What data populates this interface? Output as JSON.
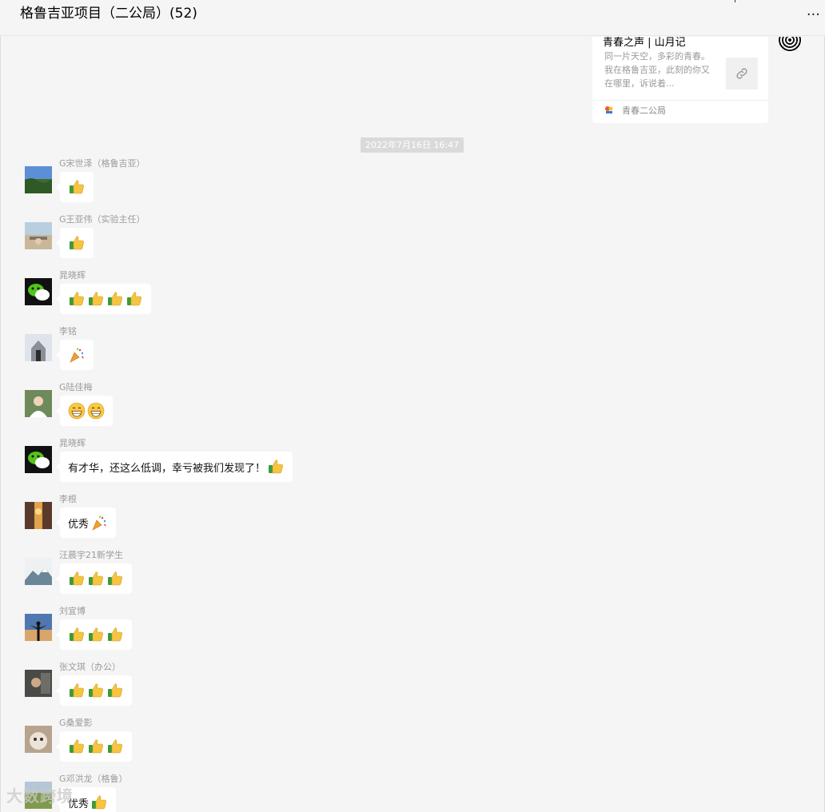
{
  "header": {
    "title": "格鲁吉亚项目（二公局）(52)",
    "more_icon": "more-horizontal-icon"
  },
  "link_card": {
    "title": "青春之声 | 山月记",
    "description": "同一片天空，多彩的青春。我在格鲁吉亚，此刻的你又在哪里，诉说着...",
    "thumb_icon": "link-icon",
    "source": "青春二公局"
  },
  "timestamp": "2022年7月16日 16:47",
  "messages": [
    {
      "sender": "G宋世泽（格鲁吉亚）",
      "avatar": "landscape-avatar",
      "text": "",
      "emojis": [
        "thumbs-up"
      ]
    },
    {
      "sender": "G王亚伟（实验主任）",
      "avatar": "road-avatar",
      "text": "",
      "emojis": [
        "thumbs-up"
      ]
    },
    {
      "sender": "晁晓辉",
      "avatar": "wechat-avatar",
      "text": "",
      "emojis": [
        "thumbs-up",
        "thumbs-up",
        "thumbs-up",
        "thumbs-up"
      ]
    },
    {
      "sender": "李铭",
      "avatar": "snow-avatar",
      "text": "",
      "emojis": [
        "party-popper"
      ]
    },
    {
      "sender": "G陆佳梅",
      "avatar": "person-avatar",
      "text": "",
      "emojis": [
        "grin",
        "grin"
      ]
    },
    {
      "sender": "晁晓辉",
      "avatar": "wechat-avatar",
      "text": "有才华，还这么低调，幸亏被我们发现了！",
      "emojis": [
        "thumbs-up"
      ]
    },
    {
      "sender": "李根",
      "avatar": "sunset-avatar",
      "text": "优秀",
      "emojis": [
        "party-popper"
      ]
    },
    {
      "sender": "汪晨宇21新学生",
      "avatar": "mountain-avatar",
      "text": "",
      "emojis": [
        "thumbs-up",
        "thumbs-up",
        "thumbs-up"
      ]
    },
    {
      "sender": "刘宜博",
      "avatar": "silhouette-avatar",
      "text": "",
      "emojis": [
        "thumbs-up",
        "thumbs-up",
        "thumbs-up"
      ]
    },
    {
      "sender": "张文琪（办公）",
      "avatar": "indoor-avatar",
      "text": "",
      "emojis": [
        "thumbs-up",
        "thumbs-up",
        "thumbs-up"
      ]
    },
    {
      "sender": "G桑爱影",
      "avatar": "cat-avatar",
      "text": "",
      "emojis": [
        "thumbs-up",
        "thumbs-up",
        "thumbs-up"
      ]
    },
    {
      "sender": "G邓洪龙（格鲁）",
      "avatar": "field-avatar",
      "text": "优秀",
      "emojis": [
        "thumbs-up"
      ]
    }
  ],
  "watermark": "大数跨境",
  "colors": {
    "background": "#f5f5f5",
    "bubble": "#ffffff",
    "sender_text": "#9b9b9b",
    "timestamp_bg": "#dadada"
  }
}
